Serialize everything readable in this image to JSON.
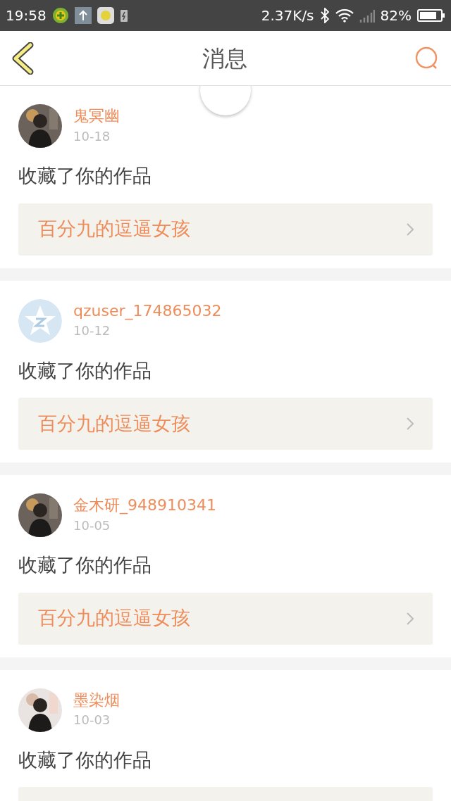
{
  "status_bar": {
    "time": "19:58",
    "speed": "2.37K/s",
    "battery": "82%"
  },
  "header": {
    "title": "消息"
  },
  "messages": [
    {
      "user": "鬼冥幽",
      "date": "10-18",
      "action": "收藏了你的作品",
      "work": "百分九的逗逼女孩"
    },
    {
      "user": "qzuser_174865032",
      "date": "10-12",
      "action": "收藏了你的作品",
      "work": "百分九的逗逼女孩",
      "avatar": {
        "kind": "default"
      }
    },
    {
      "user": "金木研_948910341",
      "date": "10-05",
      "action": "收藏了你的作品",
      "work": "百分九的逗逼女孩"
    },
    {
      "user": "墨染烟",
      "date": "10-03",
      "action": "收藏了你的作品"
    }
  ]
}
